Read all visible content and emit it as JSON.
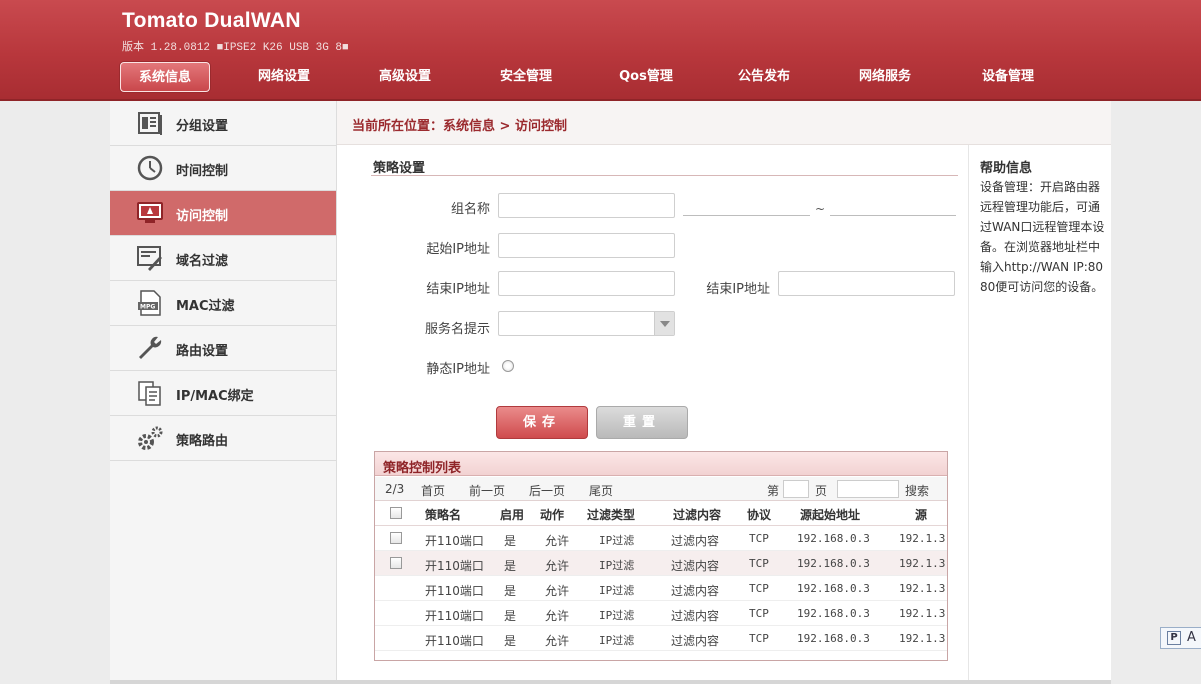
{
  "brand": "Tomato DualWAN",
  "version": "版本 1.28.0812  ■IPSE2 K26 USB 3G 8■",
  "nav": [
    {
      "label": "系统信息",
      "active": true
    },
    {
      "label": "网络设置"
    },
    {
      "label": "高级设置"
    },
    {
      "label": "安全管理"
    },
    {
      "label": "Qos管理"
    },
    {
      "label": "公告发布"
    },
    {
      "label": "网络服务"
    },
    {
      "label": "设备管理"
    }
  ],
  "sidebar": {
    "items": [
      {
        "label": "分组设置",
        "icon": "group-settings-icon"
      },
      {
        "label": "时间控制",
        "icon": "clock-icon"
      },
      {
        "label": "访问控制",
        "icon": "monitor-icon",
        "active": true
      },
      {
        "label": "域名过滤",
        "icon": "domain-filter-icon"
      },
      {
        "label": "MAC过滤",
        "icon": "mpg-file-icon"
      },
      {
        "label": "路由设置",
        "icon": "wrench-icon"
      },
      {
        "label": "IP/MAC绑定",
        "icon": "documents-icon"
      },
      {
        "label": "策略路由",
        "icon": "gears-icon"
      }
    ]
  },
  "breadcrumb": "当前所在位置：系统信息 > 访问控制",
  "form": {
    "section_title": "策略设置",
    "group_name_label": "组名称",
    "start_ip_label": "起始IP地址",
    "end_ip_label": "结束IP地址",
    "end_ip_label_2": "结束IP地址",
    "service_label": "服务名提示",
    "static_ip_label": "静态IP地址",
    "range_sep": "~",
    "save_label": "保存",
    "reset_label": "重置"
  },
  "help": {
    "title": "帮助信息",
    "text": "设备管理：开启路由器远程管理功能后，可通过WAN口远程管理本设备。在浏览器地址栏中输入http://WAN IP:8080便可访问您的设备。"
  },
  "table": {
    "title": "策略控制列表",
    "page_info": "2/3",
    "first": "首页",
    "prev": "前一页",
    "next": "后一页",
    "last": "尾页",
    "page_prefix": "第",
    "page_suffix": "页",
    "search_label": "搜索",
    "columns": [
      "策略名",
      "启用",
      "动作",
      "过滤类型",
      "过滤内容",
      "协议",
      "源起始地址",
      "源"
    ],
    "rows": [
      [
        "开110端口",
        "是",
        "允许",
        "IP过滤",
        "过滤内容",
        "TCP",
        "192.168.0.3",
        "192.1.3"
      ],
      [
        "开110端口",
        "是",
        "允许",
        "IP过滤",
        "过滤内容",
        "TCP",
        "192.168.0.3",
        "192.1.3"
      ],
      [
        "开110端口",
        "是",
        "允许",
        "IP过滤",
        "过滤内容",
        "TCP",
        "192.168.0.3",
        "192.1.3"
      ],
      [
        "开110端口",
        "是",
        "允许",
        "IP过滤",
        "过滤内容",
        "TCP",
        "192.168.0.3",
        "192.1.3"
      ],
      [
        "开110端口",
        "是",
        "允许",
        "IP过滤",
        "过滤内容",
        "TCP",
        "192.168.0.3",
        "192.1.3"
      ]
    ]
  },
  "float_tab": {
    "box": "P",
    "letter": "A"
  },
  "colors": {
    "brand_red": "#b8373c",
    "active_side": "#d06a6a",
    "crumb_text": "#9b2a2e"
  }
}
